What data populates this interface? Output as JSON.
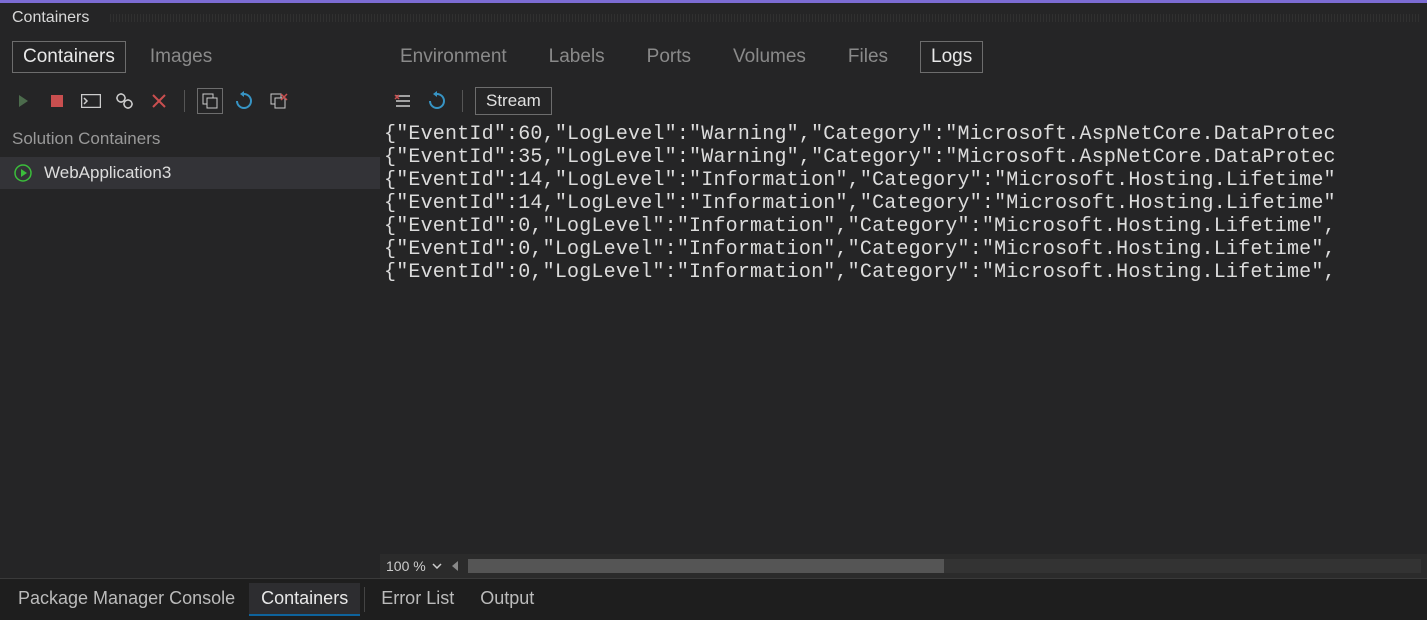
{
  "panel": {
    "title": "Containers"
  },
  "left_tabs": [
    {
      "label": "Containers",
      "active": true
    },
    {
      "label": "Images",
      "active": false
    }
  ],
  "right_tabs": [
    {
      "label": "Environment",
      "active": false
    },
    {
      "label": "Labels",
      "active": false
    },
    {
      "label": "Ports",
      "active": false
    },
    {
      "label": "Volumes",
      "active": false
    },
    {
      "label": "Files",
      "active": false
    },
    {
      "label": "Logs",
      "active": true
    }
  ],
  "sidebar": {
    "section_label": "Solution Containers",
    "items": [
      {
        "name": "WebApplication3",
        "running": true
      }
    ]
  },
  "stream_button": "Stream",
  "zoom_level": "100 %",
  "logs": [
    "{\"EventId\":60,\"LogLevel\":\"Warning\",\"Category\":\"Microsoft.AspNetCore.DataProtec",
    "{\"EventId\":35,\"LogLevel\":\"Warning\",\"Category\":\"Microsoft.AspNetCore.DataProtec",
    "{\"EventId\":14,\"LogLevel\":\"Information\",\"Category\":\"Microsoft.Hosting.Lifetime\"",
    "{\"EventId\":14,\"LogLevel\":\"Information\",\"Category\":\"Microsoft.Hosting.Lifetime\"",
    "{\"EventId\":0,\"LogLevel\":\"Information\",\"Category\":\"Microsoft.Hosting.Lifetime\",",
    "{\"EventId\":0,\"LogLevel\":\"Information\",\"Category\":\"Microsoft.Hosting.Lifetime\",",
    "{\"EventId\":0,\"LogLevel\":\"Information\",\"Category\":\"Microsoft.Hosting.Lifetime\","
  ],
  "bottom_tabs": [
    {
      "label": "Package Manager Console",
      "active": false
    },
    {
      "label": "Containers",
      "active": true
    },
    {
      "label": "Error List",
      "active": false
    },
    {
      "label": "Output",
      "active": false
    }
  ]
}
